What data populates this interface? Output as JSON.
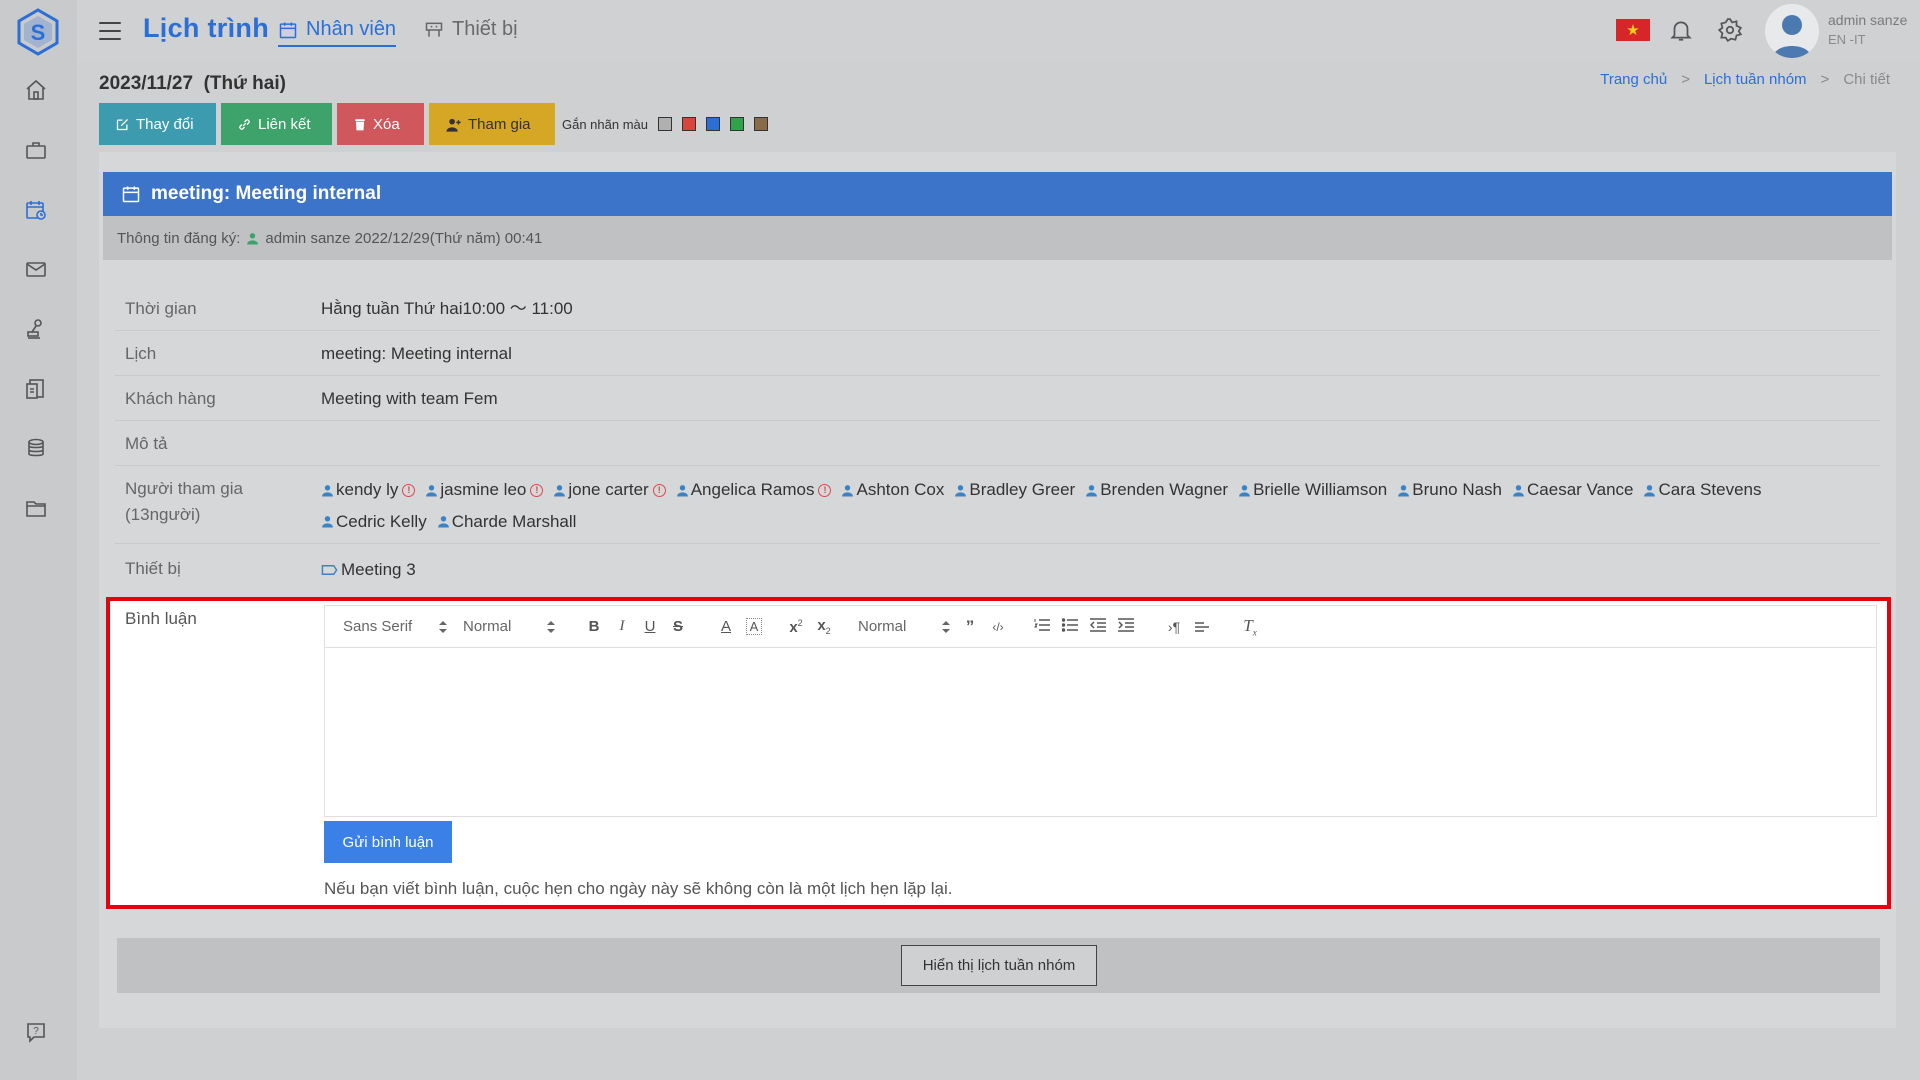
{
  "app": {
    "title": "Lịch trình"
  },
  "nav": {
    "tab_staff": "Nhân viên",
    "tab_equipment": "Thiết bị"
  },
  "user": {
    "name": "admin sanze",
    "lang": "EN -IT",
    "flag_symbol": "★"
  },
  "page": {
    "date": "2023/11/27",
    "weekday": "(Thứ hai)"
  },
  "breadcrumb": {
    "home": "Trang chủ",
    "group": "Lịch tuần nhóm",
    "current": "Chi tiết",
    "sep": ">"
  },
  "actions": {
    "edit": "Thay đổi",
    "link": "Liên kết",
    "delete": "Xóa",
    "join": "Tham gia",
    "tag_label": "Gắn nhãn màu",
    "tag_colors": [
      "#b0b0b0",
      "#d9443b",
      "#2b6fd6",
      "#2fa34a",
      "#8b6a4a"
    ]
  },
  "event": {
    "header": "meeting: Meeting internal",
    "reg_label": "Thông tin đăng ký:",
    "reg_value": "admin sanze 2022/12/29(Thứ năm) 00:41"
  },
  "details": {
    "time_label": "Thời gian",
    "time_value": "Hằng tuần Thứ hai10:00 ～ 11:00",
    "calendar_label": "Lịch",
    "calendar_value": "meeting: Meeting internal",
    "customer_label": "Khách hàng",
    "customer_value": "Meeting with team Fem",
    "desc_label": "Mô tả",
    "participants_label": "Người tham gia",
    "participants_count": "(13người)",
    "participants": [
      {
        "name": "kendy ly",
        "warn": true
      },
      {
        "name": "jasmine leo",
        "warn": true
      },
      {
        "name": "jone carter",
        "warn": true
      },
      {
        "name": "Angelica Ramos",
        "warn": true
      },
      {
        "name": "Ashton Cox",
        "warn": false
      },
      {
        "name": "Bradley Greer",
        "warn": false
      },
      {
        "name": "Brenden Wagner",
        "warn": false
      },
      {
        "name": "Brielle Williamson",
        "warn": false
      },
      {
        "name": "Bruno Nash",
        "warn": false
      },
      {
        "name": "Caesar Vance",
        "warn": false
      },
      {
        "name": "Cara Stevens",
        "warn": false
      },
      {
        "name": "Cedric Kelly",
        "warn": false
      },
      {
        "name": "Charde Marshall",
        "warn": false
      }
    ],
    "equipment_label": "Thiết bị",
    "equipment_value": "Meeting 3"
  },
  "comment": {
    "label": "Bình luận",
    "font_select": "Sans Serif",
    "size_select": "Normal",
    "heading_select": "Normal",
    "submit": "Gửi bình luận",
    "note": "Nếu bạn viết bình luận, cuộc hẹn cho ngày này sẽ không còn là một lịch hẹn lặp lại."
  },
  "footer": {
    "show_group": "Hiển thị lịch tuần nhóm"
  }
}
